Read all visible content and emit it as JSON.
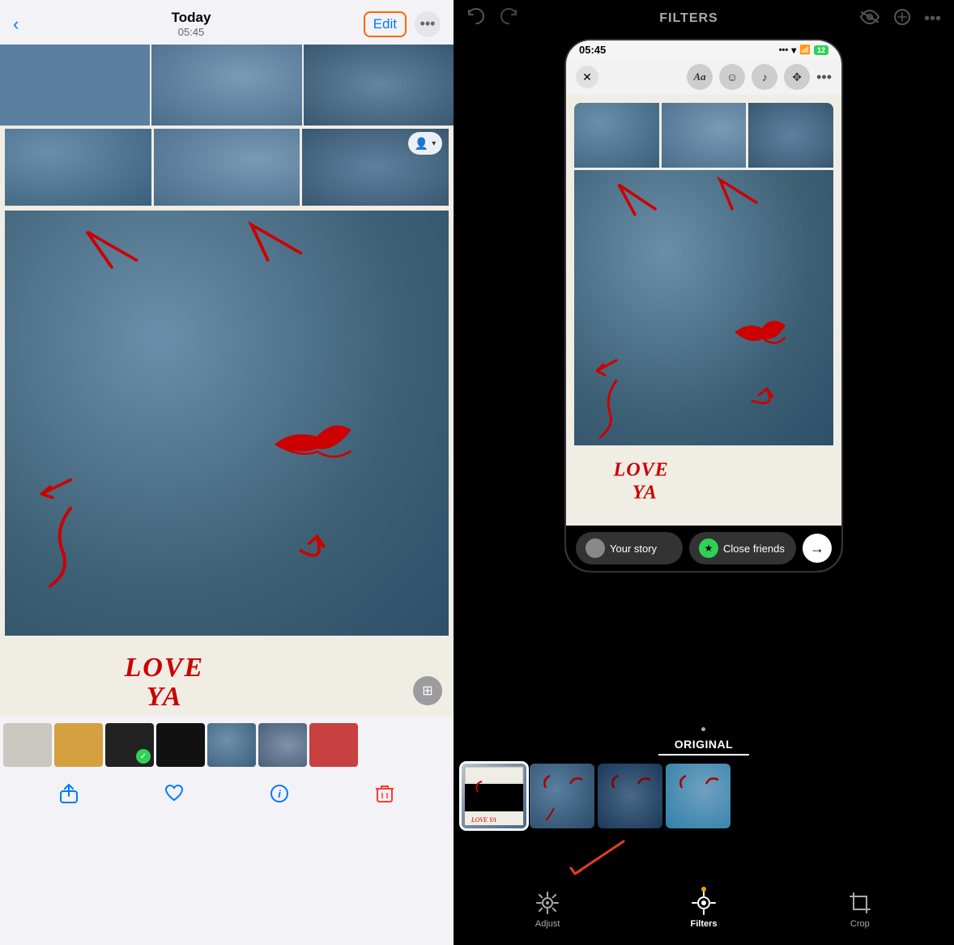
{
  "left": {
    "header": {
      "title": "Today",
      "subtitle": "05:45",
      "edit_label": "Edit",
      "back_icon": "←",
      "more_icon": "···"
    },
    "bottom_toolbar": {
      "share_icon": "⬆",
      "heart_icon": "♡",
      "info_icon": "ⓘ",
      "delete_icon": "🗑"
    },
    "thumbnails": [
      "1",
      "2",
      "3",
      "4",
      "5",
      "6",
      "7"
    ]
  },
  "right": {
    "top_bar": {
      "undo_icon": "↩",
      "redo_icon": "↪",
      "title": "FILTERS",
      "hide_icon": "◉",
      "draw_icon": "✏",
      "more_icon": "···"
    },
    "phone": {
      "time": "05:45",
      "filter_name": "ORIGINAL"
    },
    "share": {
      "story_label": "Your story",
      "close_friends_label": "Close friends"
    },
    "bottom_tools": {
      "adjust_label": "Adjust",
      "filters_label": "Filters",
      "crop_label": "Crop"
    }
  }
}
